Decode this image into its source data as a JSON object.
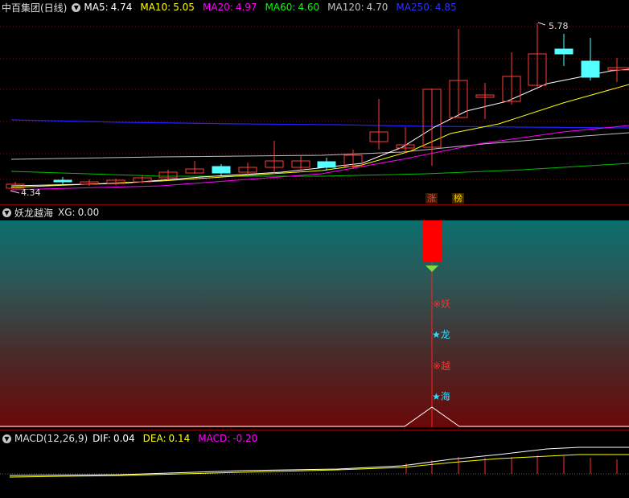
{
  "main_panel": {
    "title": "中百集团(日线)",
    "ma": [
      {
        "label": "MA5:",
        "value": "4.74",
        "color": "#ffffff"
      },
      {
        "label": "MA10:",
        "value": "5.05",
        "color": "#ffff00"
      },
      {
        "label": "MA20:",
        "value": "4.97",
        "color": "#ff00ff"
      },
      {
        "label": "MA60:",
        "value": "4.60",
        "color": "#00ff00"
      },
      {
        "label": "MA120:",
        "value": "4.70",
        "color": "#c0c0c0"
      },
      {
        "label": "MA250:",
        "value": "4.85",
        "color": "#3030ff"
      }
    ],
    "high_marker": "5.78",
    "low_marker": "4.34",
    "badges": [
      "涨",
      "榜"
    ]
  },
  "indicator_panel": {
    "title": "妖龙越海",
    "xg_label": "XG:",
    "xg_value": "0.00",
    "signals": [
      "※妖",
      "★龙",
      "※越",
      "★海"
    ]
  },
  "macd_panel": {
    "title": "MACD(12,26,9)",
    "dif_label": "DIF:",
    "dif_value": "0.04",
    "dea_label": "DEA:",
    "dea_value": "0.14",
    "macd_label": "MACD:",
    "macd_value": "-0.20"
  },
  "colors": {
    "up": "#ff3c3c",
    "down": "#54ffff",
    "background": "#000000",
    "separator": "#8b0000"
  }
}
